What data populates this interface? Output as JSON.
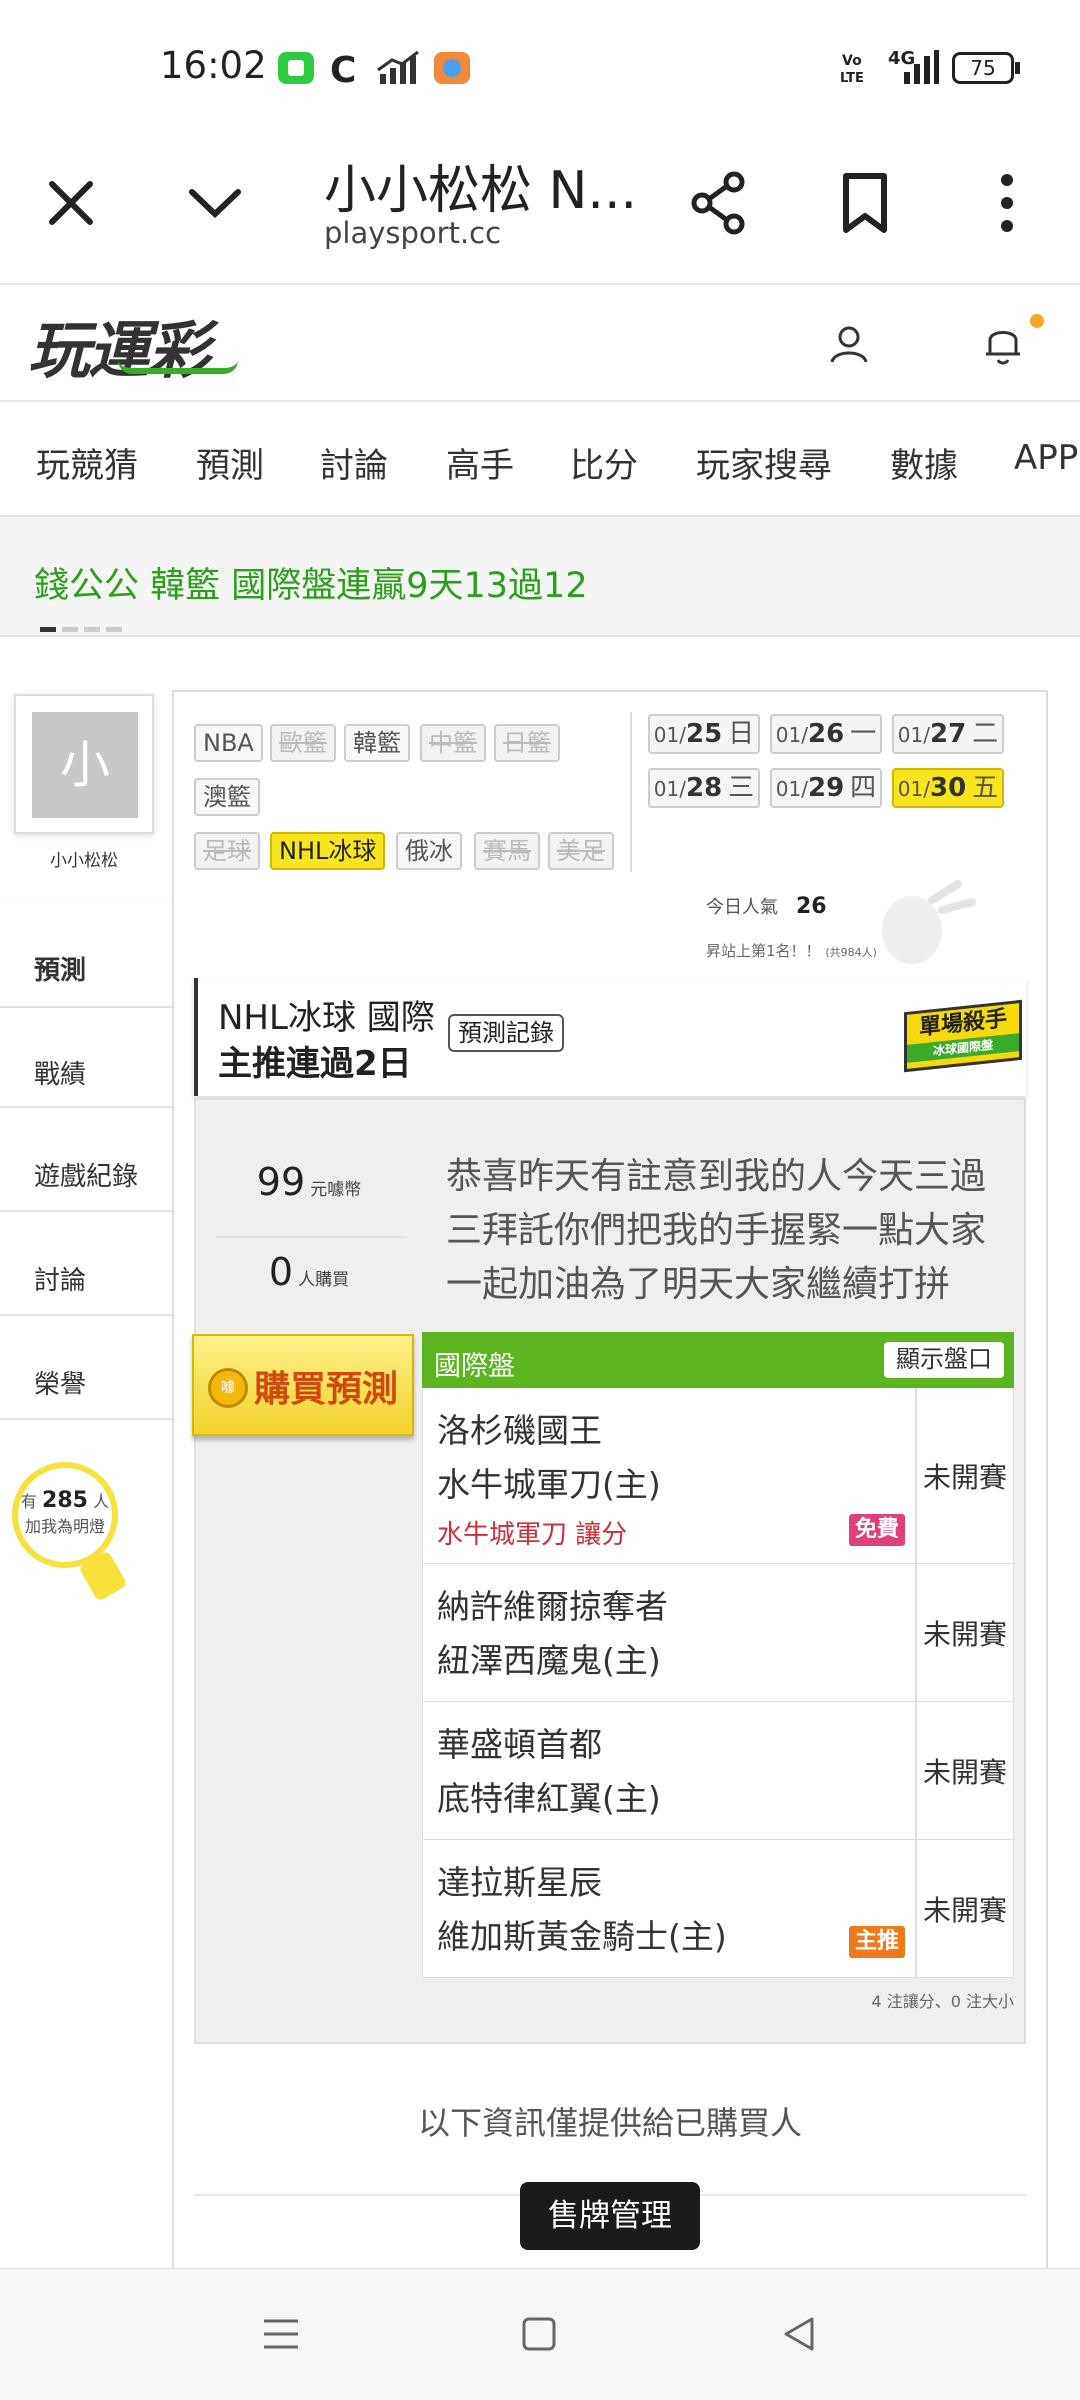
{
  "status_bar": {
    "time": "16:02",
    "network": "4G",
    "battery": "75"
  },
  "browser": {
    "title": "小小松松 N...",
    "url": "playsport.cc"
  },
  "site": {
    "logo": "玩運彩"
  },
  "nav": {
    "items": [
      "玩競猜",
      "預測",
      "討論",
      "高手",
      "比分",
      "玩家搜尋",
      "數據",
      "APP"
    ]
  },
  "marquee": {
    "text": "錢公公  韓籃 國際盤連贏9天13過12"
  },
  "profile": {
    "avatar_char": "小",
    "name": "小小松松"
  },
  "side_menu": {
    "items": [
      "預測",
      "戰績",
      "遊戲紀錄",
      "討論",
      "榮譽"
    ]
  },
  "fans": {
    "prefix": "有",
    "count": "285",
    "suffix": "人",
    "label": "加我為明燈"
  },
  "league_tags": [
    {
      "label": "NBA",
      "state": "normal"
    },
    {
      "label": "歐籃",
      "state": "disabled"
    },
    {
      "label": "韓籃",
      "state": "normal"
    },
    {
      "label": "中籃",
      "state": "disabled"
    },
    {
      "label": "日籃",
      "state": "disabled"
    },
    {
      "label": "澳籃",
      "state": "normal"
    },
    {
      "label": "足球",
      "state": "disabled"
    },
    {
      "label": "NHL冰球",
      "state": "active"
    },
    {
      "label": "俄冰",
      "state": "normal"
    },
    {
      "label": "賽馬",
      "state": "disabled"
    },
    {
      "label": "美足",
      "state": "disabled"
    }
  ],
  "dates": [
    {
      "md": "01/",
      "d": "25",
      "w": "日",
      "active": false
    },
    {
      "md": "01/",
      "d": "26",
      "w": "一",
      "active": false
    },
    {
      "md": "01/",
      "d": "27",
      "w": "二",
      "active": false
    },
    {
      "md": "01/",
      "d": "28",
      "w": "三",
      "active": false
    },
    {
      "md": "01/",
      "d": "29",
      "w": "四",
      "active": false
    },
    {
      "md": "01/",
      "d": "30",
      "w": "五",
      "active": true
    }
  ],
  "popularity": {
    "label": "今日人氣",
    "value": "26",
    "rank": "昇站上第1名！！",
    "rank_note": "(共984人)"
  },
  "header": {
    "line1": "NHL冰球 國際",
    "line2": "主推連過2日",
    "record_button": "預測記錄",
    "badge": "單場殺手",
    "badge_sub": "冰球國際盤"
  },
  "price": {
    "value": "99",
    "unit": "元噱幣"
  },
  "buyers": {
    "value": "0",
    "unit": "人購買"
  },
  "message": "恭喜昨天有註意到我的人今天三過三拜託你們把我的手握緊一點大家一起加油為了明天大家繼續打拼",
  "buy_button": {
    "coin": "噱",
    "label": "購買預測"
  },
  "table": {
    "title": "國際盤",
    "show_button": "顯示盤口",
    "rows": [
      {
        "away": "洛杉磯國王",
        "home": "水牛城軍刀(主)",
        "pick": "水牛城軍刀 讓分",
        "chip": "免費",
        "status": "未開賽"
      },
      {
        "away": "納許維爾掠奪者",
        "home": "紐澤西魔鬼(主)",
        "pick": "",
        "chip": "",
        "status": "未開賽"
      },
      {
        "away": "華盛頓首都",
        "home": "底特律紅翼(主)",
        "pick": "",
        "chip": "",
        "status": "未開賽"
      },
      {
        "away": "達拉斯星辰",
        "home": "維加斯黃金騎士(主)",
        "pick": "",
        "chip": "主推",
        "status": "未開賽"
      }
    ],
    "summary": "4 注讓分、0 注大小"
  },
  "info_text": "以下資訊僅提供給已購買人",
  "manage_button": "售牌管理",
  "colors": {
    "brand_green": "#3aab2b",
    "highlight_yellow": "#f8e51f",
    "table_green": "#5ab51e",
    "free_chip": "#e0407a",
    "main_chip": "#f07a1a"
  }
}
